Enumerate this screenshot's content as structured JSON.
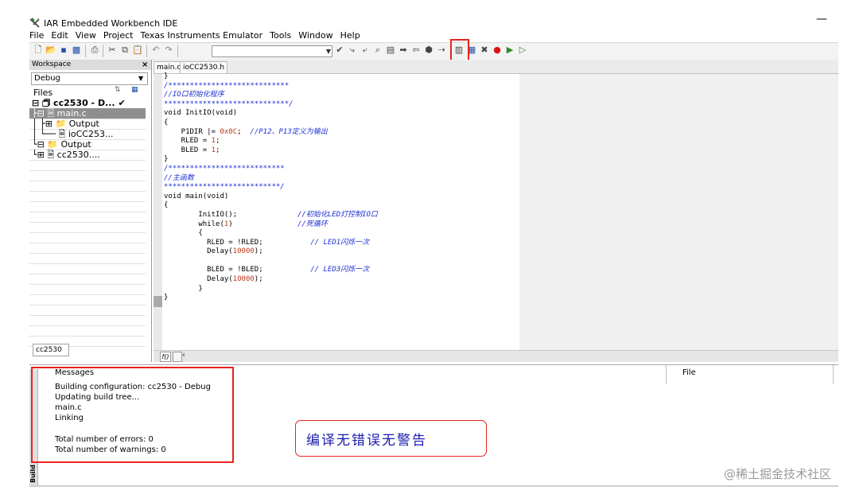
{
  "window": {
    "title": "IAR Embedded Workbench IDE",
    "minimize_glyph": "—"
  },
  "menu": [
    "File",
    "Edit",
    "View",
    "Project",
    "Texas Instruments Emulator",
    "Tools",
    "Window",
    "Help"
  ],
  "workspace": {
    "header": "Workspace",
    "close_glyph": "×",
    "config": "Debug",
    "files_label": "Files",
    "tree": [
      {
        "text": "⊟ 🗇 cc2530 - D...   ✔",
        "indent": 0,
        "bold": true,
        "selected": false
      },
      {
        "text": "├⊟ 🗎 main.c",
        "indent": 0,
        "bold": false,
        "selected": true
      },
      {
        "text": "│ ├⊞ 📁 Output",
        "indent": 0,
        "bold": false,
        "selected": false
      },
      {
        "text": "│ └── 🗎 ioCC253...",
        "indent": 0,
        "bold": false,
        "selected": false
      },
      {
        "text": "└⊟ 📁 Output",
        "indent": 0,
        "bold": false,
        "selected": false
      },
      {
        "text": "  └⊞ 🗎 cc2530....",
        "indent": 0,
        "bold": false,
        "selected": false
      }
    ],
    "tab": "cc2530"
  },
  "editor": {
    "tabs": [
      "main.c",
      "ioCC2530.h"
    ],
    "fn_button": "f()"
  },
  "messages": {
    "header": "Messages",
    "file_col": "File",
    "lines": [
      "Building configuration: cc2530 - Debug",
      "Updating build tree...",
      "main.c",
      "Linking",
      "",
      "Total number of errors: 0",
      "Total number of warnings: 0"
    ],
    "vtab": "Build"
  },
  "annotation": "编译无错误无警告",
  "watermark": "@稀土掘金技术社区",
  "colors": {
    "highlight": "#e8231f",
    "comment": "#1a2fd4",
    "number": "#c03a1a"
  }
}
